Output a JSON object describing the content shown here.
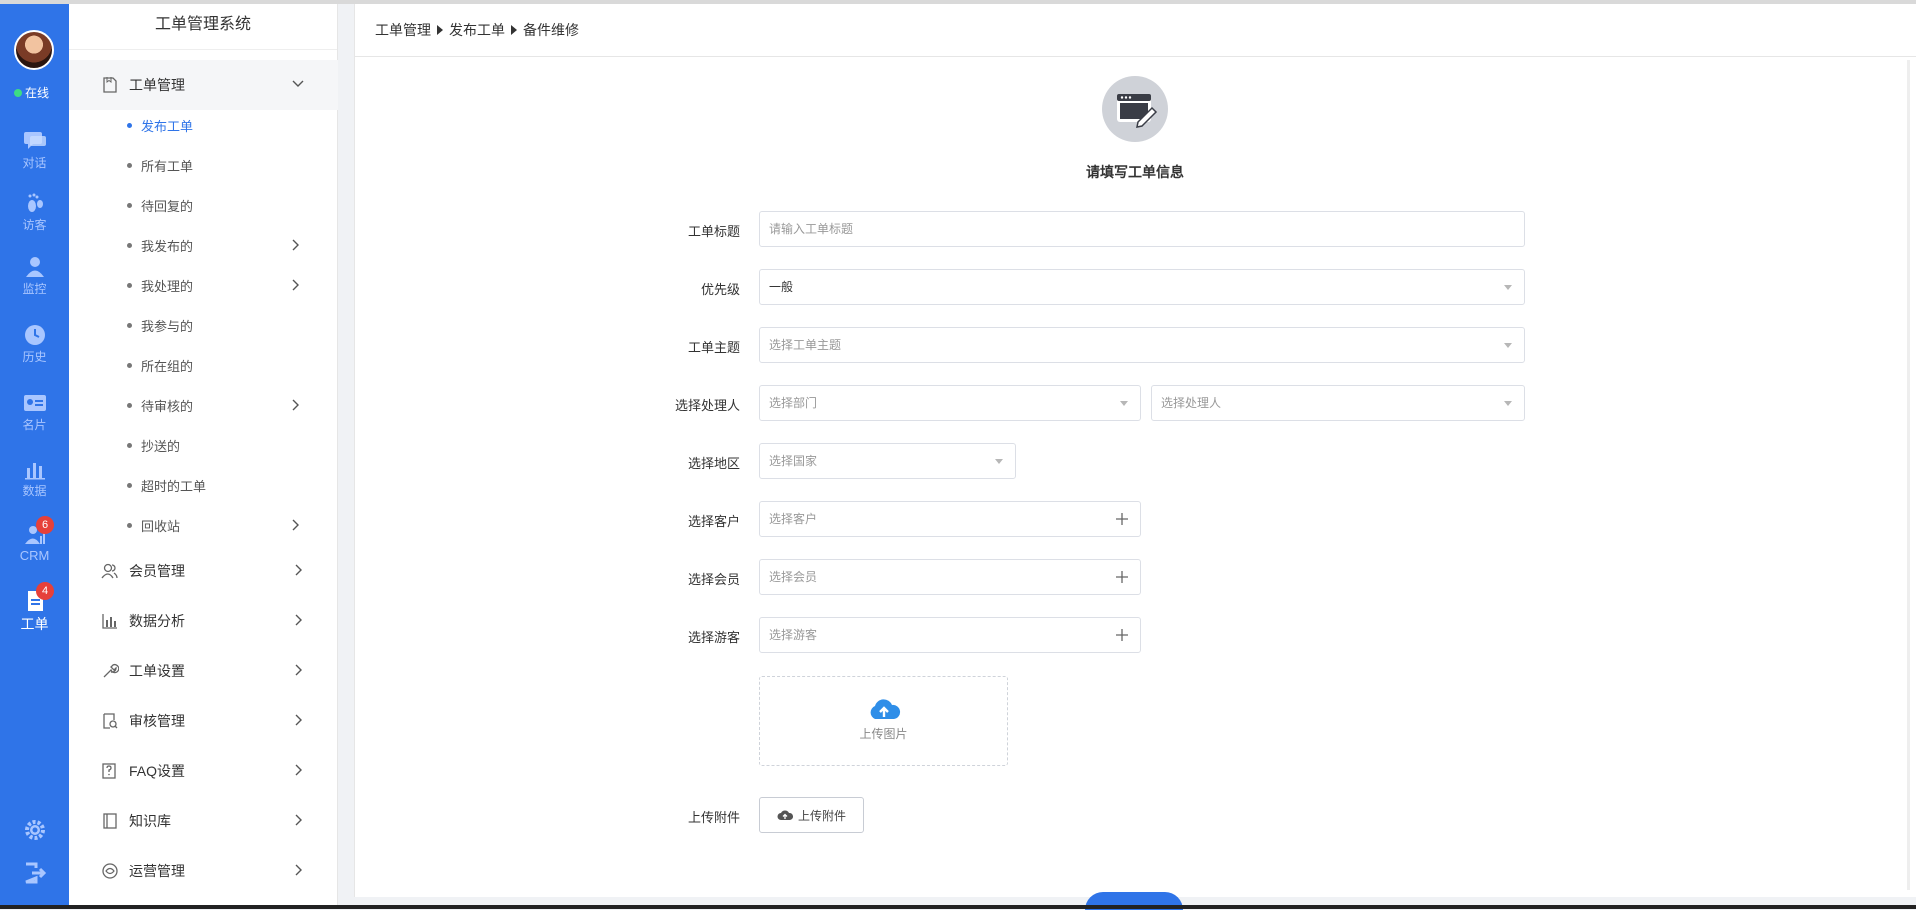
{
  "rail": {
    "status": "在线",
    "items": [
      {
        "label": "对话",
        "icon": "chat-icon"
      },
      {
        "label": "访客",
        "icon": "footprint-icon"
      },
      {
        "label": "监控",
        "icon": "monitor-user-icon"
      },
      {
        "label": "历史",
        "icon": "clock-icon"
      },
      {
        "label": "名片",
        "icon": "card-icon"
      },
      {
        "label": "数据",
        "icon": "bar-chart-icon"
      },
      {
        "label": "CRM",
        "icon": "crm-icon",
        "badge": "6"
      },
      {
        "label": "工单",
        "icon": "ticket-icon",
        "badge": "4"
      }
    ],
    "accent": "#2f74e8"
  },
  "sub": {
    "title": "工单管理系统",
    "groups": [
      {
        "label": "工单管理",
        "icon": "ticket-doc-icon"
      },
      {
        "label": "会员管理",
        "icon": "members-icon"
      },
      {
        "label": "数据分析",
        "icon": "analytics-icon"
      },
      {
        "label": "工单设置",
        "icon": "wrench-icon"
      },
      {
        "label": "审核管理",
        "icon": "review-icon"
      },
      {
        "label": "FAQ设置",
        "icon": "faq-icon"
      },
      {
        "label": "知识库",
        "icon": "book-icon"
      },
      {
        "label": "运营管理",
        "icon": "operations-icon"
      }
    ],
    "leaves": [
      {
        "label": "发布工单"
      },
      {
        "label": "所有工单"
      },
      {
        "label": "待回复的"
      },
      {
        "label": "我发布的"
      },
      {
        "label": "我处理的"
      },
      {
        "label": "我参与的"
      },
      {
        "label": "所在组的"
      },
      {
        "label": "待审核的"
      },
      {
        "label": "抄送的"
      },
      {
        "label": "超时的工单"
      },
      {
        "label": "回收站"
      }
    ]
  },
  "breadcrumb": [
    "工单管理",
    "发布工单",
    "备件维修"
  ],
  "form": {
    "heading": "请填写工单信息",
    "title_label": "工单标题",
    "title_placeholder": "请输入工单标题",
    "priority_label": "优先级",
    "priority_value": "一般",
    "topic_label": "工单主题",
    "topic_placeholder": "选择工单主题",
    "handler_label": "选择处理人",
    "dept_placeholder": "选择部门",
    "handler_placeholder": "选择处理人",
    "region_label": "选择地区",
    "country_placeholder": "选择国家",
    "customer_label": "选择客户",
    "customer_placeholder": "选择客户",
    "member_label": "选择会员",
    "member_placeholder": "选择会员",
    "visitor_label": "选择游客",
    "visitor_placeholder": "选择游客",
    "upload_image": "上传图片",
    "attachment_label": "上传附件",
    "attachment_button": "上传附件"
  }
}
